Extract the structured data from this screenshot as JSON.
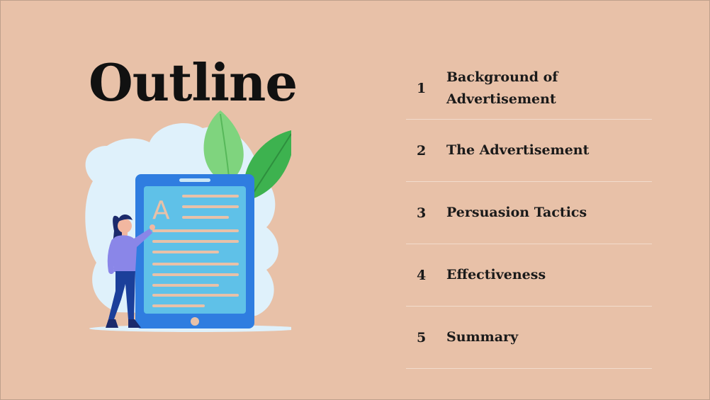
{
  "slide": {
    "title": "Outline",
    "items": [
      {
        "number": "1",
        "label_line1": "Background of",
        "label_line2": "Advertisement"
      },
      {
        "number": "2",
        "label": "The Advertisement"
      },
      {
        "number": "3",
        "label": "Persuasion Tactics"
      },
      {
        "number": "4",
        "label": "Effectiveness"
      },
      {
        "number": "5",
        "label": "Summary"
      }
    ],
    "illustration_letter": "A",
    "colors": {
      "background": "#e8c1a8",
      "tablet": "#2f7de0",
      "screen": "#5fc1e8",
      "lines": "#e8c1a8",
      "blob": "#dff1fb",
      "leaf_light": "#7fd47e",
      "leaf_dark": "#3db24f"
    }
  }
}
